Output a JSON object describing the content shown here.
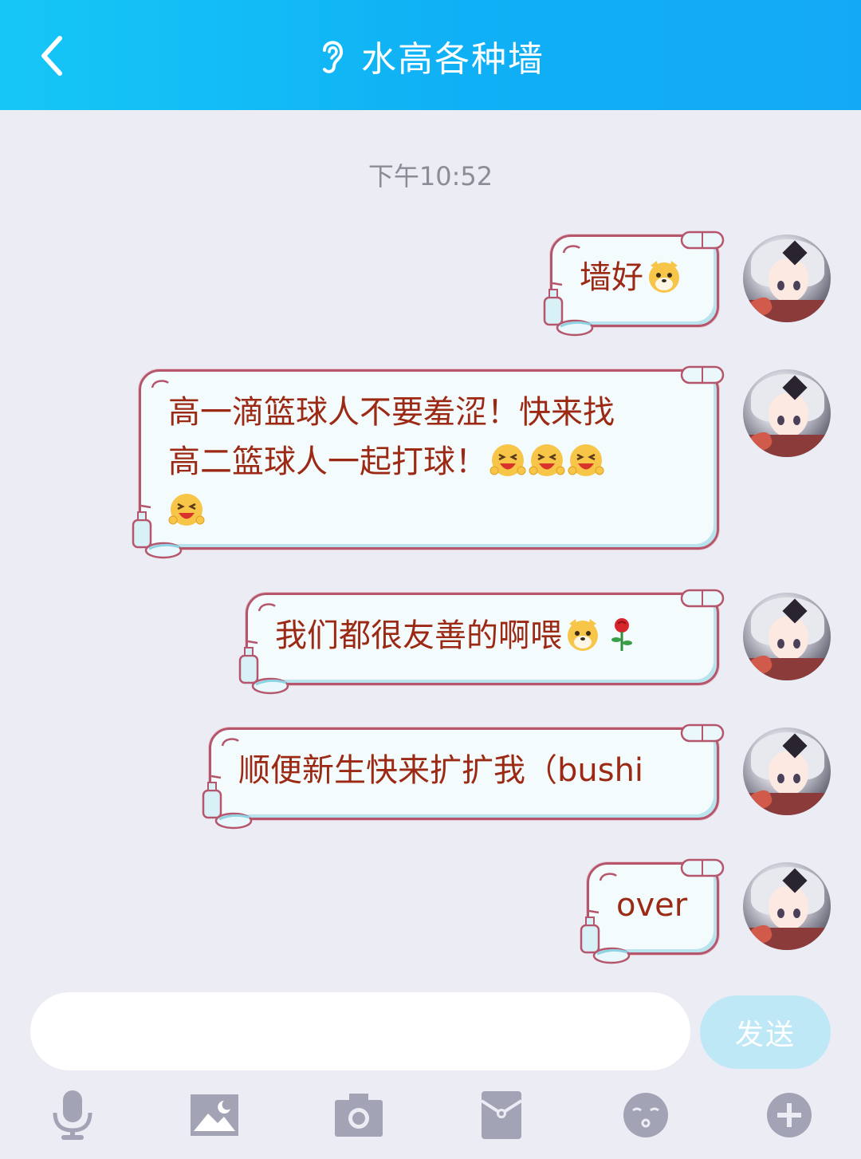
{
  "header": {
    "back_label": "back",
    "title": "水高各种墙"
  },
  "timestamp": "下午10:52",
  "messages": [
    {
      "text": "墙好",
      "emojis": [
        "dog-face-emoji"
      ]
    },
    {
      "text": "高一滴篮球人不要羞涩！快来找\n高二篮球人一起打球！",
      "emojis": [
        "laughing-cry-emoji",
        "laughing-cry-emoji",
        "laughing-cry-emoji",
        "laughing-cry-emoji"
      ]
    },
    {
      "text": "我们都很友善的啊喂",
      "emojis": [
        "dog-face-emoji",
        "rose-emoji"
      ]
    },
    {
      "text": "顺便新生快来扩扩我（bushi",
      "emojis": []
    },
    {
      "text": "over",
      "emojis": []
    }
  ],
  "input": {
    "placeholder": "",
    "value": ""
  },
  "send_button": "发送",
  "toolbar": [
    "microphone-icon",
    "image-icon",
    "camera-icon",
    "red-packet-icon",
    "emoji-icon",
    "plus-icon"
  ],
  "colors": {
    "header": "#12b7f5",
    "bubble_text": "#9c2913",
    "bubble_border": "#b6566d",
    "send_disabled": "#bfe8f7"
  }
}
